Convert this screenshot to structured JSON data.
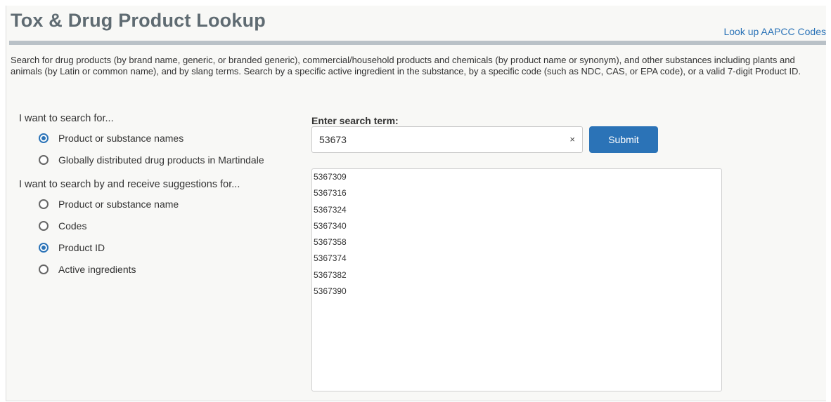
{
  "header": {
    "title": "Tox & Drug Product Lookup",
    "aapcc_link": "Look up AAPCC Codes"
  },
  "description": "Search for drug products (by brand name, generic, or branded generic), commercial/household products and chemicals (by product name or synonym), and other substances including plants and animals (by Latin or common name), and by slang terms. Search by a specific active ingredient in the substance, by a specific code (such as NDC, CAS, or EPA code), or a valid 7-digit Product ID.",
  "search_for": {
    "heading": "I want to search for...",
    "options": [
      {
        "label": "Product or substance names",
        "checked": true
      },
      {
        "label": "Globally distributed drug products in Martindale",
        "checked": false
      }
    ]
  },
  "search_by": {
    "heading": "I want to search by and receive suggestions for...",
    "options": [
      {
        "label": "Product or substance name",
        "checked": false
      },
      {
        "label": "Codes",
        "checked": false
      },
      {
        "label": "Product ID",
        "checked": true
      },
      {
        "label": "Active ingredients",
        "checked": false
      }
    ]
  },
  "search": {
    "label": "Enter search term:",
    "value": "53673",
    "clear_glyph": "×",
    "submit_label": "Submit"
  },
  "suggestions": [
    "5367309",
    "5367316",
    "5367324",
    "5367340",
    "5367358",
    "5367374",
    "5367382",
    "5367390"
  ],
  "colors": {
    "accent": "#2b73b7",
    "title": "#5f6b72",
    "rule": "#b9c1c7",
    "panel_bg": "#f8f8f6"
  }
}
